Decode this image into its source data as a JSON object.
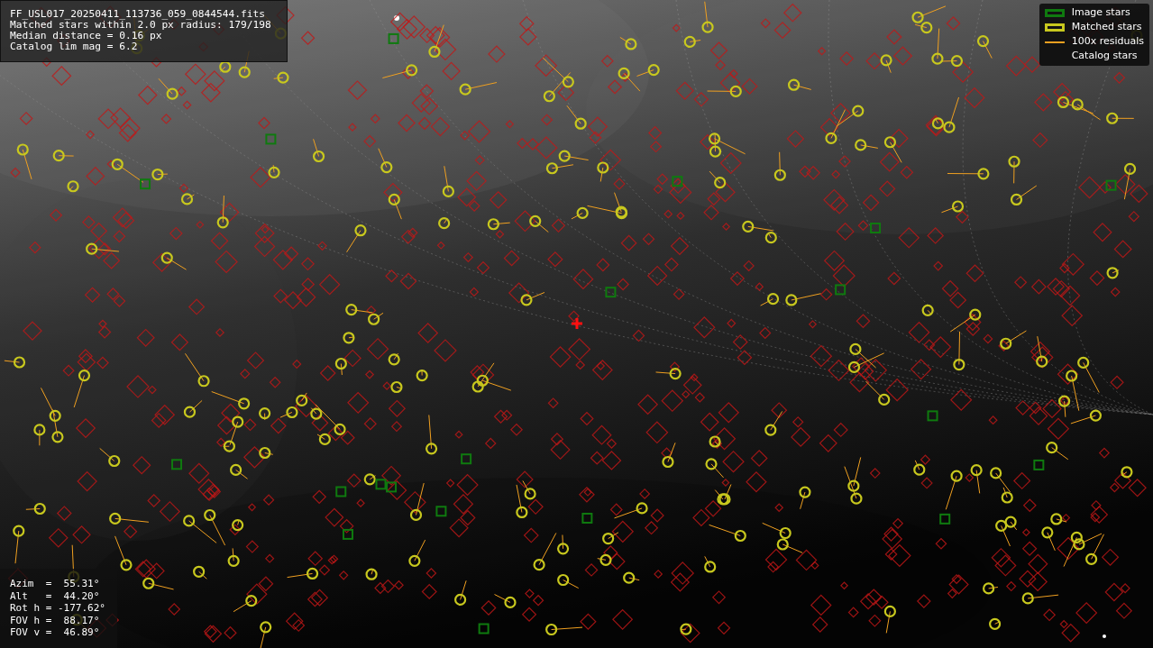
{
  "info_box": {
    "lines": [
      "FF_USL017_20250411_113736_059_0844544.fits",
      "Matched stars within 2.0 px radius: 179/198",
      "Median distance = 0.16 px",
      "Catalog lim mag = 6.2"
    ]
  },
  "legend": {
    "items": [
      {
        "kind": "box",
        "label": "Image stars",
        "color": "#0f7a0f"
      },
      {
        "kind": "box",
        "label": "Matched stars",
        "color": "#c8c81e"
      },
      {
        "kind": "line",
        "label": "100x residuals",
        "color": "#f0a020"
      },
      {
        "kind": "none",
        "label": "Catalog stars"
      }
    ]
  },
  "pointing": {
    "lines": [
      "Azim  =  55.31°",
      "Alt   =  44.20°",
      "Rot h = -177.62°",
      "FOV h =  88.17°",
      "FOV v =  46.89°"
    ]
  }
}
